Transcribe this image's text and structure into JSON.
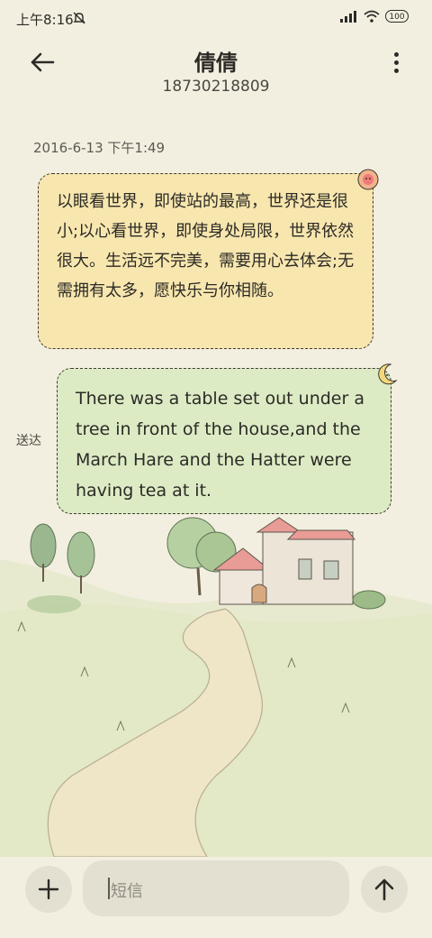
{
  "status_bar": {
    "time": "上午8:16",
    "battery": "100",
    "icons": [
      "mute-icon",
      "signal-icon",
      "wifi-icon",
      "battery-icon"
    ]
  },
  "header": {
    "contact_name": "倩倩",
    "contact_number": "18730218809",
    "icons": [
      "back-arrow-icon",
      "more-vertical-icon"
    ]
  },
  "conversation": {
    "timestamp": "2016-6-13 下午1:49",
    "messages": [
      {
        "direction": "incoming",
        "text": "以眼看世界，即使站的最高，世界还是很小;以心看世界，即使身处局限，世界依然很大。生活远不完美，需要用心去体会;无需拥有太多，愿快乐与你相随。",
        "decoration_icon": "flower-icon"
      },
      {
        "direction": "outgoing",
        "text": "There was a table set out under a tree in front of the house,and the March Hare and the Hatter were having tea at it.",
        "status": "送达",
        "decoration_icon": "moon-icon"
      }
    ]
  },
  "composer": {
    "placeholder": "短信",
    "icons": [
      "plus-icon",
      "send-arrow-up-icon"
    ]
  },
  "colors": {
    "background": "#f3efe0",
    "incoming_bubble": "#f7e6ae",
    "outgoing_bubble": "#dcebc4",
    "button_bg": "#e4e0d1"
  }
}
